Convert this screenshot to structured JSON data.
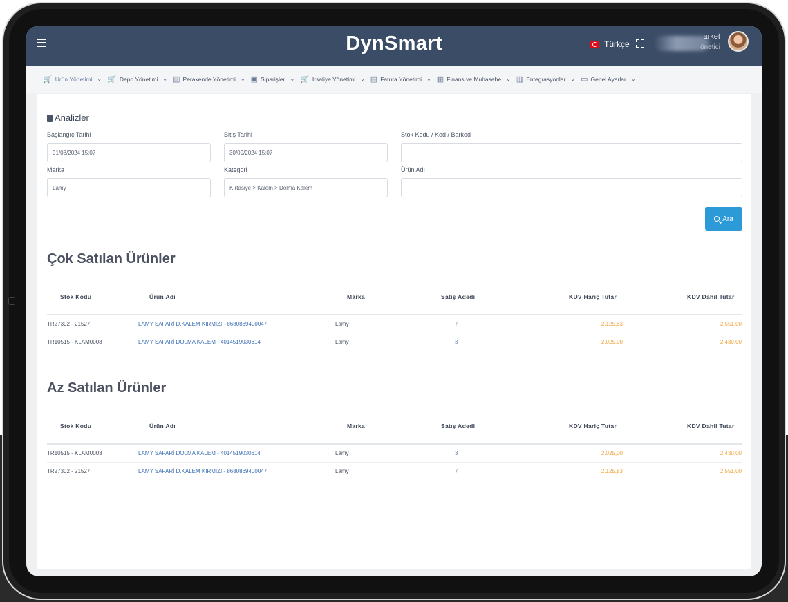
{
  "header": {
    "brand": "DynSmart",
    "language": "Türkçe",
    "user_name": "arket",
    "user_role": "önetici"
  },
  "menu": [
    {
      "label": "Ürün Yönetimi",
      "icon": "cart-icon"
    },
    {
      "label": "Depo Yönetimi",
      "icon": "cart-icon"
    },
    {
      "label": "Perakende Yönetimi",
      "icon": "map-icon"
    },
    {
      "label": "Siparişler",
      "icon": "truck-icon"
    },
    {
      "label": "İrsaliye Yönetimi",
      "icon": "cart-icon"
    },
    {
      "label": "Fatura Yönetimi",
      "icon": "document-icon"
    },
    {
      "label": "Finans ve Muhasebe",
      "icon": "calculator-icon"
    },
    {
      "label": "Entegrasyonlar",
      "icon": "map-icon"
    },
    {
      "label": "Genel Ayarlar",
      "icon": "folder-icon"
    }
  ],
  "filters": {
    "title": "Analizler",
    "start_label": "Başlangıç Tarihi",
    "start_value": "01/08/2024 15:07",
    "end_label": "Bitiş Tarihi",
    "end_value": "30/09/2024 15:07",
    "stock_label": "Stok Kodu / Kod / Barkod",
    "stock_value": "",
    "brand_label": "Marka",
    "brand_value": "Lamy",
    "category_label": "Kategori",
    "category_value": "Kırtasiye > Kalem > Dolma Kalem",
    "product_label": "Ürün Adı",
    "product_value": "",
    "search_button": "Ara"
  },
  "columns": [
    "Stok Kodu",
    "Ürün Adı",
    "Marka",
    "Satış Adedi",
    "KDV Hariç Tutar",
    "KDV Dahil Tutar"
  ],
  "best_sellers": {
    "title": "Çok Satılan Ürünler",
    "rows": [
      {
        "code": "TR27302 - 21527",
        "name": "LAMY SAFARİ D.KALEM KIRMIZI - 8680869400047",
        "brand": "Lamy",
        "qty": "7",
        "net": "2.125,83",
        "gross": "2.551,00"
      },
      {
        "code": "TR10515 - KLAM0003",
        "name": "LAMY SAFARİ DOLMA KALEM - 4014519030614",
        "brand": "Lamy",
        "qty": "3",
        "net": "2.025,00",
        "gross": "2.430,00"
      }
    ]
  },
  "least_sellers": {
    "title": "Az Satılan Ürünler",
    "rows": [
      {
        "code": "TR10515 - KLAM0003",
        "name": "LAMY SAFARİ DOLMA KALEM - 4014519030614",
        "brand": "Lamy",
        "qty": "3",
        "net": "2.025,00",
        "gross": "2.430,00"
      },
      {
        "code": "TR27302 - 21527",
        "name": "LAMY SAFARİ D.KALEM KIRMIZI - 8680869400047",
        "brand": "Lamy",
        "qty": "7",
        "net": "2.125,83",
        "gross": "2.551,00"
      }
    ]
  }
}
